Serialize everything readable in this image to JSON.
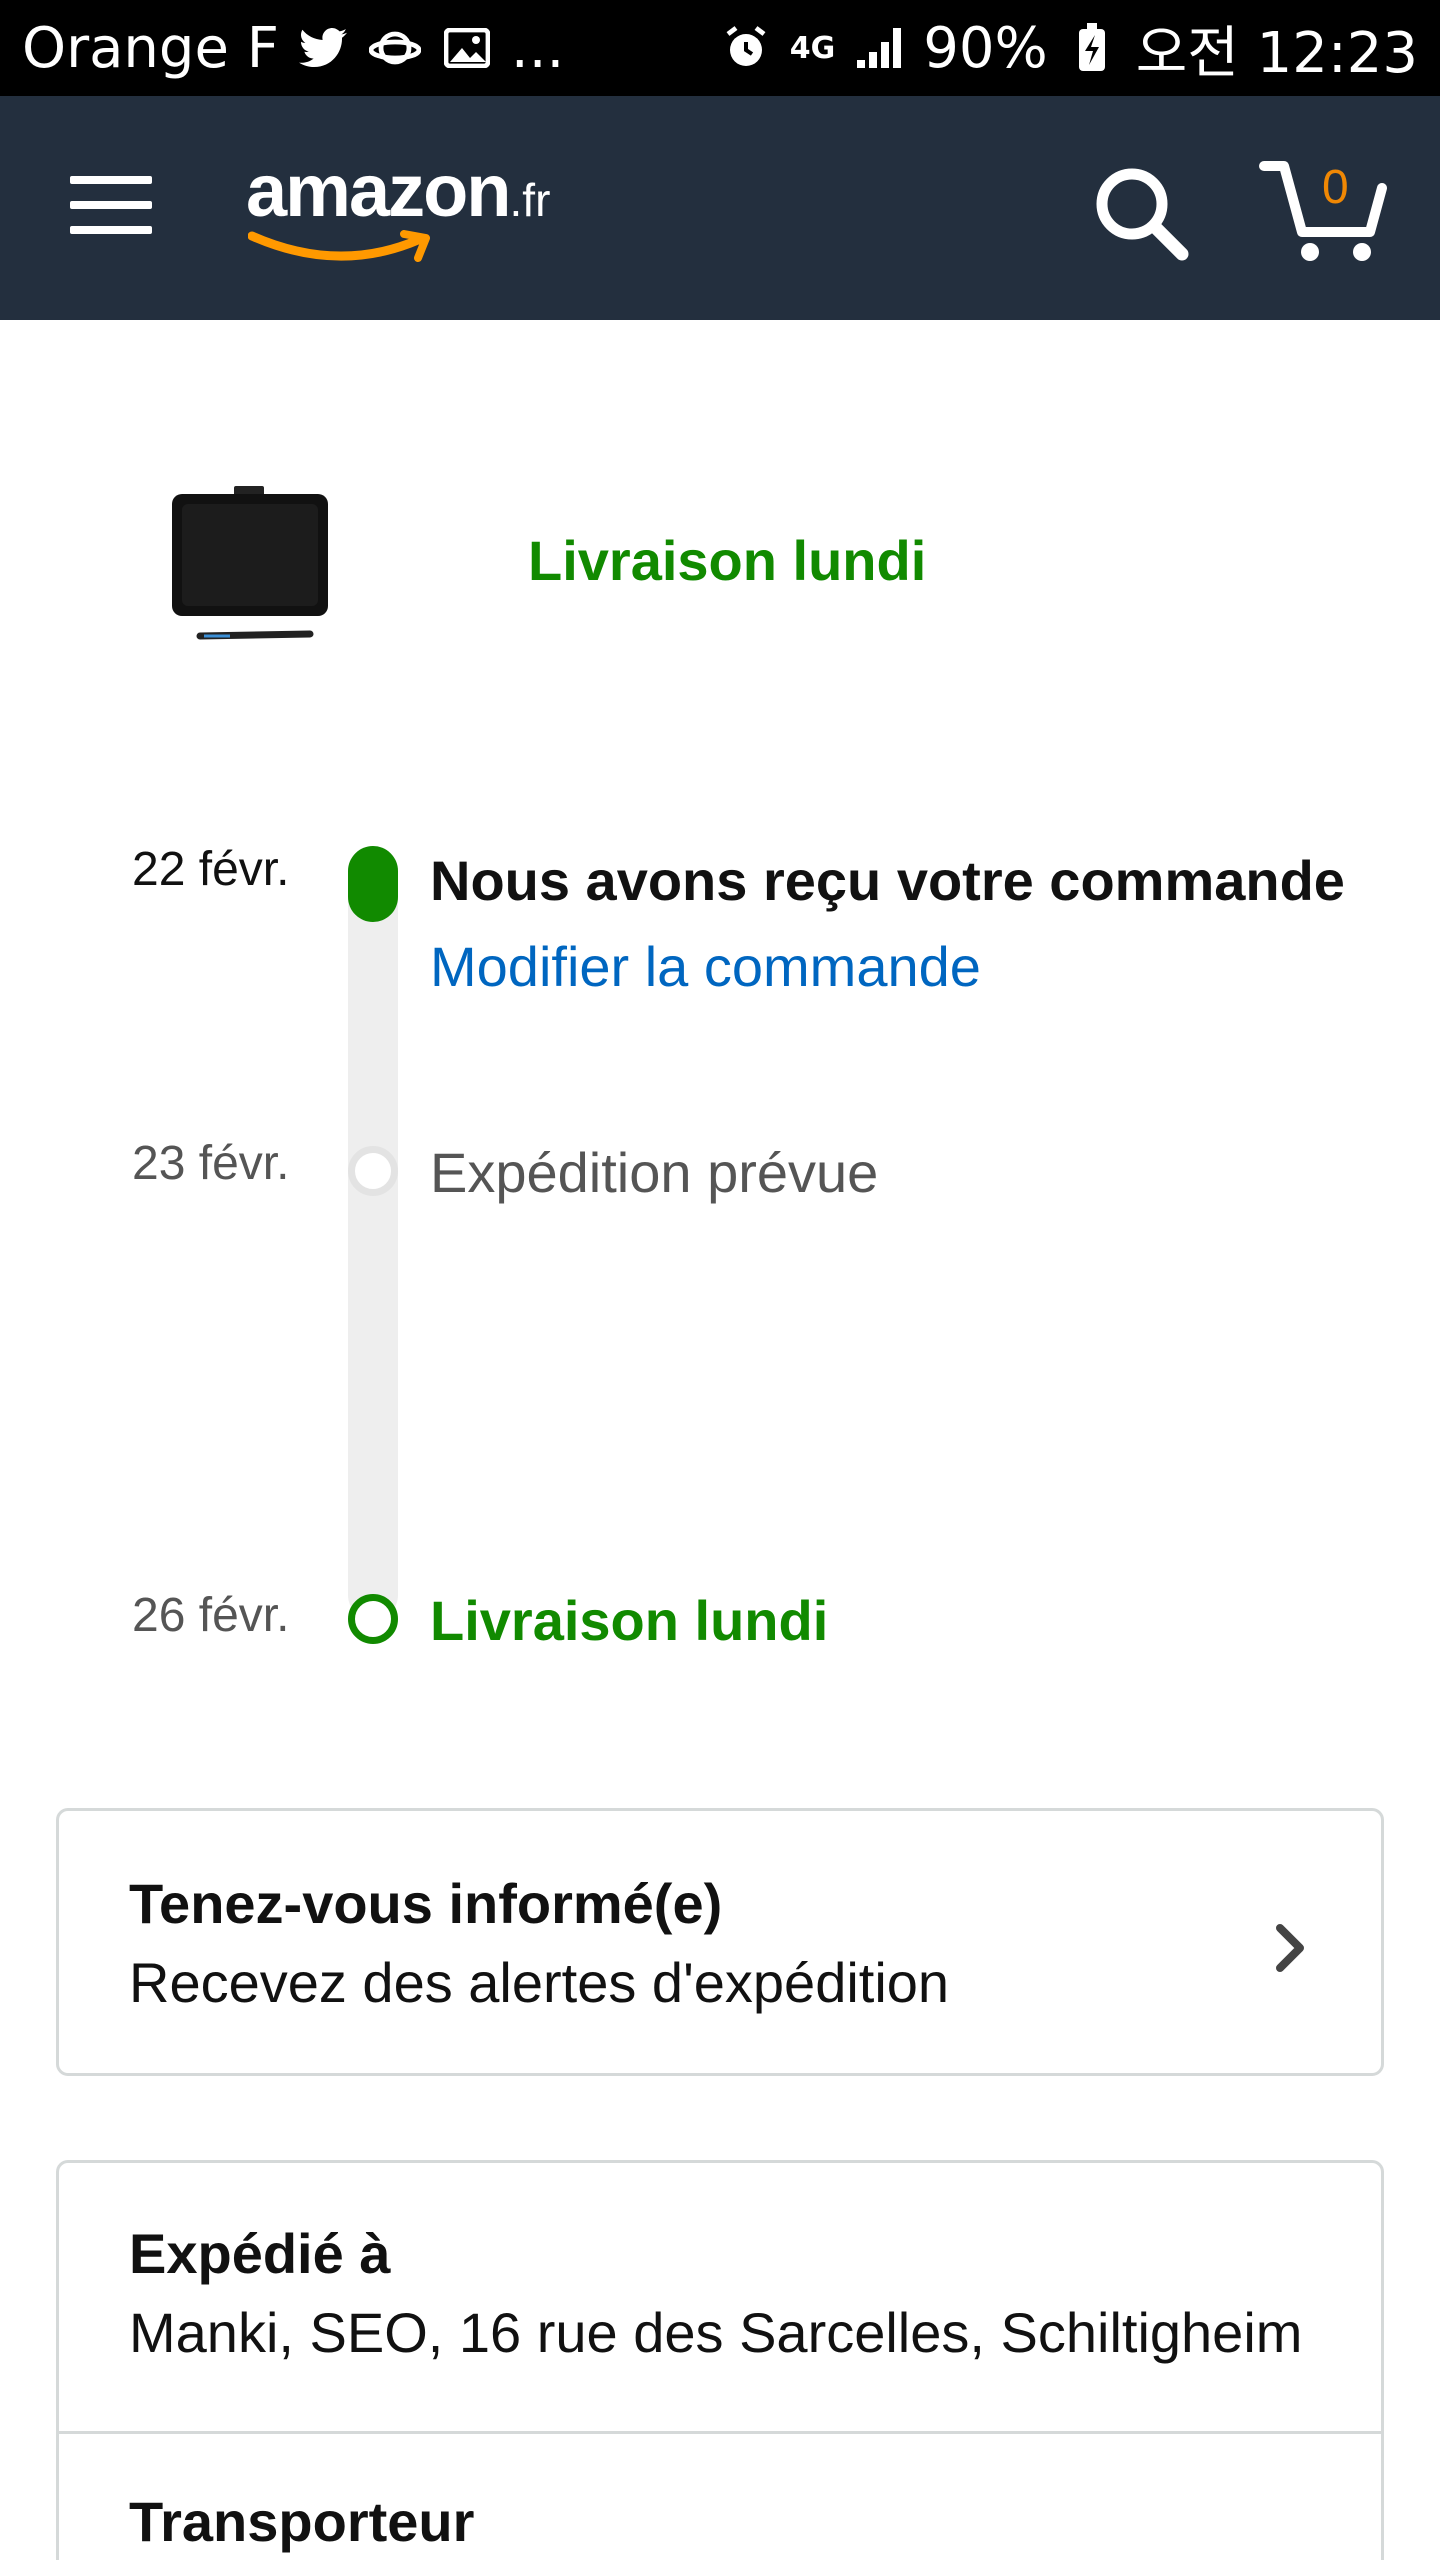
{
  "status_bar": {
    "carrier": "Orange F",
    "more": "...",
    "network": "4G",
    "battery": "90%",
    "time": "오전 12:23"
  },
  "header": {
    "logo_text": "amazon",
    "logo_tld": ".fr",
    "cart_count": "0",
    "icons": [
      "menu-icon",
      "search-icon",
      "cart-icon"
    ]
  },
  "summary": {
    "delivery_title": "Livraison lundi"
  },
  "timeline": {
    "steps": [
      {
        "date": "22 févr.",
        "label": "Nous avons reçu votre commande",
        "link": "Modifier la commande",
        "state": "done"
      },
      {
        "date": "23 févr.",
        "label": "Expédition prévue",
        "state": "pending"
      },
      {
        "date": "26 févr.",
        "label": "Livraison lundi",
        "state": "target"
      }
    ]
  },
  "alerts_card": {
    "title": "Tenez-vous informé(e)",
    "subtitle": "Recevez des alertes d'expédition"
  },
  "shipping_card": {
    "shipped_to_title": "Expédié à",
    "address": "Manki, SEO, 16 rue des Sarcelles, Schiltigheim",
    "carrier_title": "Transporteur"
  },
  "colors": {
    "header_bg": "#232f3e",
    "accent_green": "#118a00",
    "link_blue": "#0066c0",
    "cart_orange": "#f08804"
  }
}
